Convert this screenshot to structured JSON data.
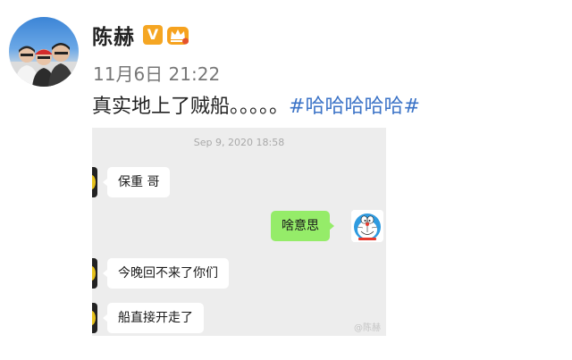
{
  "post": {
    "author_name": "陈赫",
    "vip_badge_text": "V",
    "timestamp": "11月6日 21:22",
    "content_text": "真实地上了贼船。。。。。",
    "hashtag": "#哈哈哈哈哈#",
    "hashtag_color": "#3b73c7"
  },
  "chat": {
    "timestamp": "Sep 9, 2020 18:58",
    "messages": [
      {
        "side": "received",
        "text": "保重 哥"
      },
      {
        "side": "sent",
        "text": "啥意思"
      },
      {
        "side": "received",
        "text": "今晚回不来了你们"
      },
      {
        "side": "received",
        "text": "船直接开走了"
      }
    ],
    "sent_bubble_color": "#95ec69",
    "watermark": "@陈赫"
  }
}
